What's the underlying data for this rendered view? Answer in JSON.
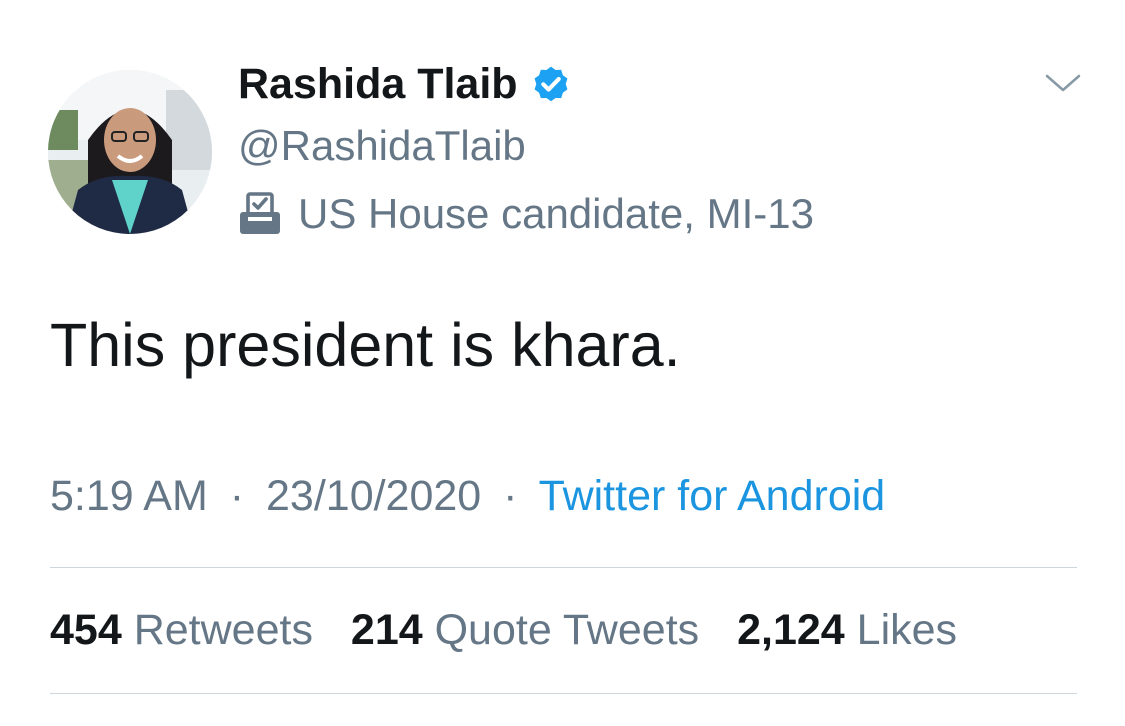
{
  "author": {
    "display_name": "Rashida Tlaib",
    "handle": "@RashidaTlaib",
    "label": "US House candidate, MI-13",
    "verified": true
  },
  "icons": {
    "verified": "verified-badge-icon",
    "label": "ballot-box-icon",
    "menu": "chevron-down-icon",
    "avatar": "profile-photo"
  },
  "tweet": {
    "text": "This president is khara."
  },
  "meta": {
    "time": "5:19 AM",
    "separator": "·",
    "date": "23/10/2020",
    "source": "Twitter for Android"
  },
  "stats": {
    "retweets_count": "454",
    "retweets_label": "Retweets",
    "quotes_count": "214",
    "quotes_label": "Quote Tweets",
    "likes_count": "2,124",
    "likes_label": "Likes"
  },
  "colors": {
    "primary_text": "#14171a",
    "secondary_text": "#657786",
    "link": "#1b95e0",
    "verified": "#1da1f2",
    "divider": "#ccd6dd"
  }
}
